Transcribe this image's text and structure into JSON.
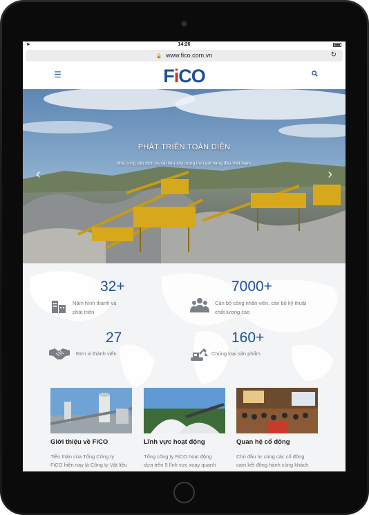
{
  "status": {
    "time": "14:26"
  },
  "browser": {
    "url": "www.fico.com.vn"
  },
  "brand": {
    "logo_text_a": "F",
    "logo_text_i": "i",
    "logo_text_b": "CO",
    "primary": "#1d4f95",
    "accent": "#e3262d"
  },
  "icons": {
    "menu": "hamburger-icon",
    "search": "search-icon",
    "prev": "chevron-left-icon",
    "next": "chevron-right-icon"
  },
  "hero": {
    "title": "PHÁT TRIỂN TOÀN DIỆN",
    "subtitle": "Nhà cung cấp dịch vụ vật liệu xây dựng trọn gói hàng đầu Việt Nam."
  },
  "stats": [
    {
      "value": "32+",
      "label_line1": "Năm hình thành và",
      "label_line2": "phát triển"
    },
    {
      "value": "7000+",
      "label_line1": "Cán bộ công nhân viên, cán bộ kỹ thuật",
      "label_line2": "chất lượng cao"
    },
    {
      "value": "27",
      "label_line1": "Đơn vị thành viên",
      "label_line2": ""
    },
    {
      "value": "160+",
      "label_line1": "Chủng loại sản phẩm",
      "label_line2": ""
    }
  ],
  "cards": [
    {
      "title": "Giới thiệu về FiCO",
      "desc_line1": "Tiền thân của Tổng Công ty",
      "desc_line2": "FiCO hiện nay là Công ty Vật liệu"
    },
    {
      "title": "Lĩnh vực hoạt động",
      "desc_line1": "Tổng công ty FiCO hoạt động",
      "desc_line2": "dựa trên 5 lĩnh vực xoay quanh"
    },
    {
      "title": "Quan hệ cổ đông",
      "desc_line1": "Chủ đầu tư cùng các cổ đông",
      "desc_line2": "cam kết đồng hành cùng khách"
    }
  ]
}
